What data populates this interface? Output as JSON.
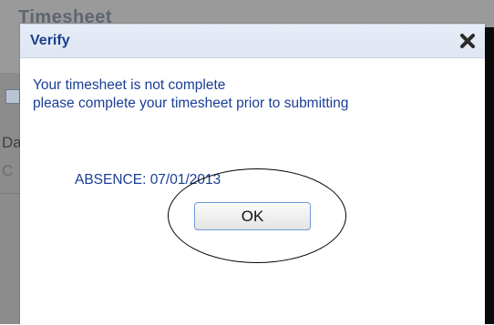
{
  "background": {
    "window_title": "Timesheet",
    "left_labels": [
      "Da",
      "C"
    ]
  },
  "dialog": {
    "title": "Verify",
    "close_icon": "close-icon",
    "message_line1": "Your timesheet is not complete",
    "message_line2": "please complete your timesheet prior to submitting",
    "absence_text": "ABSENCE: 07/01/2013",
    "ok_label": "OK"
  },
  "colors": {
    "title_blue": "#1b3f90",
    "text_blue": "#1a3d95",
    "header_bg": "#e6edf7",
    "button_border": "#6f9bd8"
  }
}
